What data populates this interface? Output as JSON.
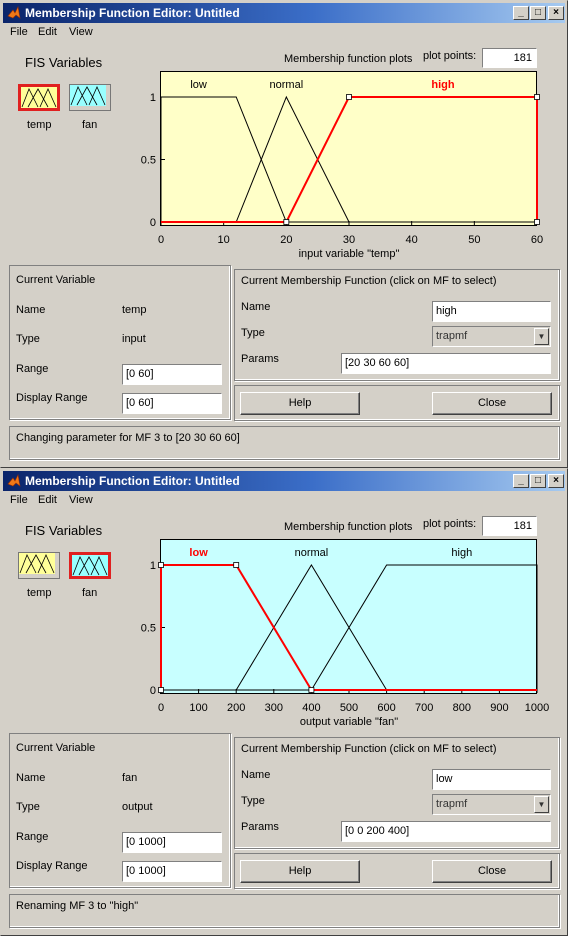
{
  "colors": {
    "selected": "#ff0000",
    "plot_bg_temp": "#ffffc8",
    "plot_bg_fan": "#c8ffff",
    "icon_temp": "#ffff99",
    "icon_fan": "#99ffff"
  },
  "windows": [
    {
      "title": "Membership Function Editor: Untitled",
      "menu": [
        "File",
        "Edit",
        "View"
      ],
      "fis_variables_label": "FIS Variables",
      "variables": [
        {
          "name": "temp",
          "selected": true
        },
        {
          "name": "fan",
          "selected": false
        }
      ],
      "plot_header": "Membership function plots",
      "plot_points_label": "plot points:",
      "plot_points": "181",
      "mf_labels": [
        "low",
        "normal",
        "high"
      ],
      "selected_mf": 2,
      "y_ticks": [
        "0",
        "0.5",
        "1"
      ],
      "x_ticks": [
        "0",
        "10",
        "20",
        "30",
        "40",
        "50",
        "60"
      ],
      "x_axis_label": "input variable \"temp\"",
      "mfs": [
        {
          "name": "low",
          "type": "trapmf",
          "params": [
            0,
            0,
            12,
            20
          ]
        },
        {
          "name": "normal",
          "type": "trimf",
          "params": [
            12,
            20,
            30
          ]
        },
        {
          "name": "high",
          "type": "trapmf",
          "params": [
            20,
            30,
            60,
            60
          ]
        }
      ],
      "x_range": [
        0,
        60
      ],
      "current_variable": {
        "title": "Current Variable",
        "name_label": "Name",
        "name": "temp",
        "type_label": "Type",
        "type": "input",
        "range_label": "Range",
        "range": "[0 60]",
        "display_range_label": "Display Range",
        "display_range": "[0 60]"
      },
      "current_mf": {
        "title": "Current Membership Function (click on MF to select)",
        "name_label": "Name",
        "name": "high",
        "type_label": "Type",
        "type": "trapmf",
        "params_label": "Params",
        "params": "[20 30 60 60]"
      },
      "help_label": "Help",
      "close_label": "Close",
      "status": "Changing parameter for MF 3 to  [20 30 60 60]"
    },
    {
      "title": "Membership Function Editor: Untitled",
      "menu": [
        "File",
        "Edit",
        "View"
      ],
      "fis_variables_label": "FIS Variables",
      "variables": [
        {
          "name": "temp",
          "selected": false
        },
        {
          "name": "fan",
          "selected": true
        }
      ],
      "plot_header": "Membership function plots",
      "plot_points_label": "plot points:",
      "plot_points": "181",
      "mf_labels": [
        "low",
        "normal",
        "high"
      ],
      "selected_mf": 0,
      "y_ticks": [
        "0",
        "0.5",
        "1"
      ],
      "x_ticks": [
        "0",
        "100",
        "200",
        "300",
        "400",
        "500",
        "600",
        "700",
        "800",
        "900",
        "1000"
      ],
      "x_axis_label": "output variable \"fan\"",
      "mfs": [
        {
          "name": "low",
          "type": "trapmf",
          "params": [
            0,
            0,
            200,
            400
          ]
        },
        {
          "name": "normal",
          "type": "trimf",
          "params": [
            200,
            400,
            600
          ]
        },
        {
          "name": "high",
          "type": "trapmf",
          "params": [
            400,
            600,
            1000,
            1000
          ]
        }
      ],
      "x_range": [
        0,
        1000
      ],
      "current_variable": {
        "title": "Current Variable",
        "name_label": "Name",
        "name": "fan",
        "type_label": "Type",
        "type": "output",
        "range_label": "Range",
        "range": "[0 1000]",
        "display_range_label": "Display Range",
        "display_range": "[0 1000]"
      },
      "current_mf": {
        "title": "Current Membership Function (click on MF to select)",
        "name_label": "Name",
        "name": "low",
        "type_label": "Type",
        "type": "trapmf",
        "params_label": "Params",
        "params": "[0 0 200 400]"
      },
      "help_label": "Help",
      "close_label": "Close",
      "status": "Renaming MF 3 to \"high\""
    }
  ]
}
